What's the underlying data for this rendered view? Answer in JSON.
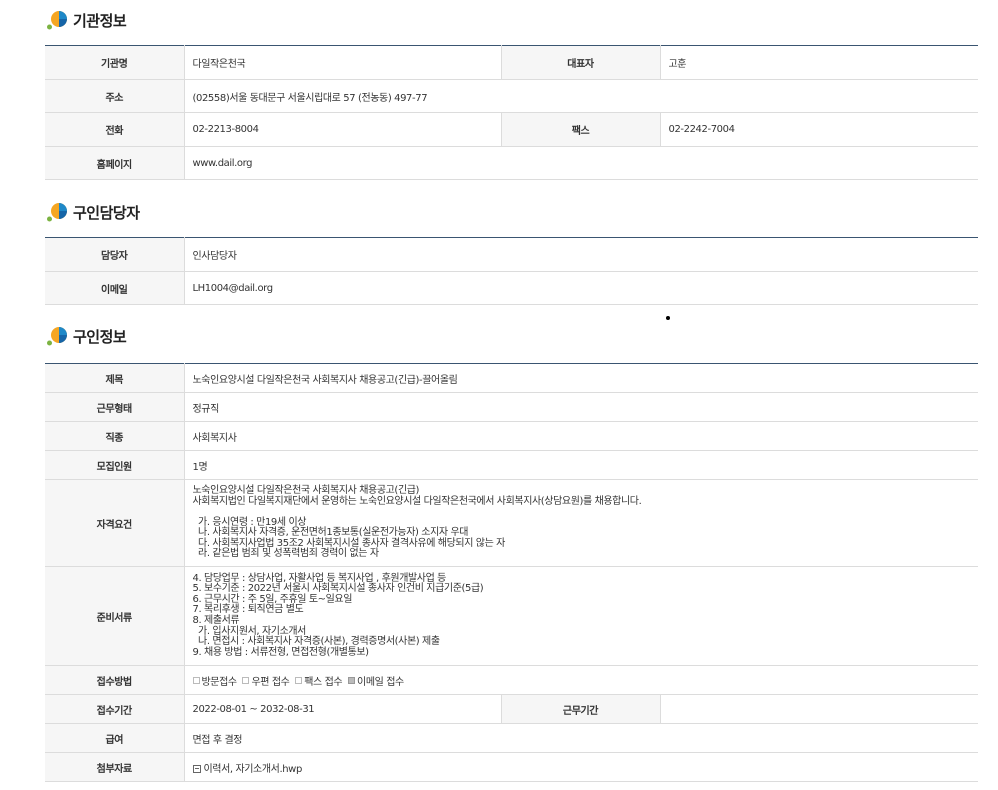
{
  "institution": {
    "title": "기관정보",
    "name_label": "기관명",
    "name": "다일작은천국",
    "ceo_label": "대표자",
    "ceo": "고훈",
    "address_label": "주소",
    "address": "(02558)서울 동대문구 서울시립대로 57 (전농동) 497-77",
    "phone_label": "전화",
    "phone": "02-2213-8004",
    "fax_label": "팩스",
    "fax": "02-2242-7004",
    "homepage_label": "홈페이지",
    "homepage": "www.dail.org"
  },
  "contact": {
    "title": "구인담당자",
    "person_label": "담당자",
    "person": "인사담당자",
    "email_label": "이메일",
    "email": "LH1004@dail.org"
  },
  "job": {
    "title": "구인정보",
    "subject_label": "제목",
    "subject": "노숙인요양시설 다일작은천국 사회복지사 채용공고(긴급)-끌어올림",
    "employment_label": "근무형태",
    "employment": "정규직",
    "occupation_label": "직종",
    "occupation": "사회복지사",
    "headcount_label": "모집인원",
    "headcount": "1명",
    "qualification_label": "자격요건",
    "qualification": "노숙인요양시설 다일작은천국 사회복지사 채용공고(긴급)\n사회복지법인 다일복지재단에서 운영하는 노숙인요양시설 다일작은천국에서 사회복지사(상담요원)를 채용합니다.\n\n  가. 응시연령 : 만19세 이상\n  나. 사회복지사 자격증, 운전면허1종보통(실운전가능자) 소지자 우대\n  다. 사회복지사업법 35조2 사회복지시설 종사자 결격사유에 해당되지 않는 자\n  라. 같은법 범죄 및 성폭력범죄 경력이 없는 자",
    "documents_label": "준비서류",
    "documents": "4. 담당업무 : 상담사업, 자활사업 등 복지사업 , 후원개발사업 등\n5. 보수기준 : 2022년 서울시 사회복지시설 종사자 인건비 지급기준(5급)\n6. 근무시간 : 주 5일, 주휴일 토~일요일\n7. 복리후생 : 퇴직연금 별도\n8. 제출서류\n  가. 입사지원서, 자기소개서\n  나. 면접시 : 사회복지사 자격증(사본), 경력증명서(사본) 제출\n9. 채용 방법 : 서류전형, 면접전형(개별통보)",
    "method_label": "접수방법",
    "methods": [
      {
        "label": "방문접수",
        "checked": false
      },
      {
        "label": "우편 접수",
        "checked": false
      },
      {
        "label": "팩스 접수",
        "checked": false
      },
      {
        "label": "이메일 접수",
        "checked": true
      }
    ],
    "period_label": "접수기간",
    "period": "2022-08-01 ~ 2032-08-31",
    "work_period_label": "근무기간",
    "work_period": "",
    "salary_label": "급여",
    "salary": "면접 후 결정",
    "attachment_label": "첨부자료",
    "attachment": "이력서, 자기소개서.hwp"
  }
}
